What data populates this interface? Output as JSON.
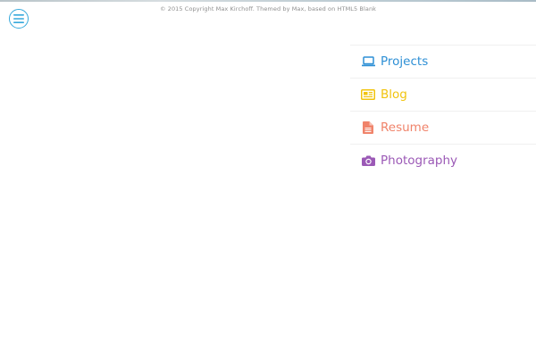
{
  "footer": {
    "credit": "© 2015 Copyright Max Kirchoff. Themed by Max, based on HTML5 Blank"
  },
  "menu": {
    "toggle_icon": "hamburger-menu-icon",
    "toggle_color": "#36a9dc"
  },
  "nav": {
    "items": [
      {
        "label": "Projects",
        "icon": "laptop-icon",
        "color": "#2d8fd5"
      },
      {
        "label": "Blog",
        "icon": "newspaper-icon",
        "color": "#f1c40f"
      },
      {
        "label": "Resume",
        "icon": "document-icon",
        "color": "#f0836a"
      },
      {
        "label": "Photography",
        "icon": "camera-icon",
        "color": "#9b59b6"
      }
    ]
  }
}
